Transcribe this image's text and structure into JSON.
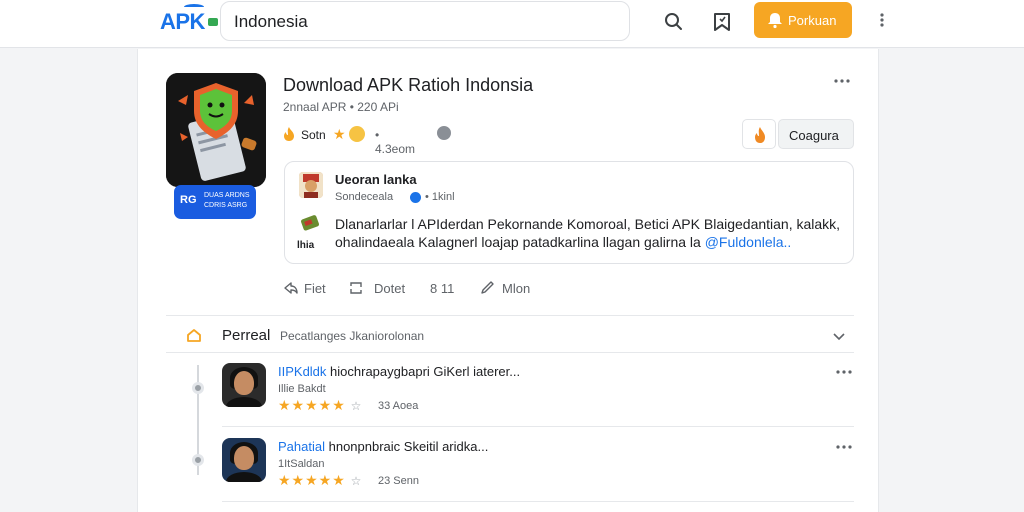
{
  "header": {
    "logo_text": "APK",
    "search": {
      "value": "Indonesia"
    },
    "primary_button_label": "Porkuan"
  },
  "app": {
    "badge_primary": "RG",
    "badge_secondary": "DUAS ARDNS CDRIS ASRG",
    "title": "Download APK Ratioh Indonsia",
    "subtitle": "2nnaal APR • 220 APi",
    "rating": "Sotn",
    "size": "• 4.3eom",
    "action_button_label": "Coagura"
  },
  "post": {
    "author": "Ueoran lanka",
    "handle": "Sondeceala",
    "time": "• 1kinl",
    "thumb_label": "lhia",
    "body_text": "Dlanarlarlar l APIderdan Pekornande Komoroal, Betici APK Blaigedantian, kalakk, ohalindaeala Kalagnerl loajap patadkarlina llagan galirna la",
    "mention": "@Fuldonlela.."
  },
  "post_actions": [
    {
      "label": "Fiet",
      "icon": "share-icon"
    },
    {
      "label": "Dotet",
      "icon": "repost-icon"
    },
    {
      "label": "8 11",
      "icon": ""
    },
    {
      "label": "Mlon",
      "icon": "reply-icon"
    }
  ],
  "section": {
    "title": "Perreal",
    "subtitle": "Pecatlanges Jkaniorolonan"
  },
  "reviews": [
    {
      "name": "IIPKdldk",
      "text": "hiochrapaygbapri GiKerl iaterer...",
      "sub": "Illie Bakdt",
      "stars": "★★★★★",
      "count": "33 Aoea"
    },
    {
      "name": "Pahatial",
      "text": "hnonpnbraic Skeitil aridka...",
      "sub": "1ItSaldan",
      "stars": "★★★★★",
      "count": "23 Senn"
    }
  ],
  "colors": {
    "accent": "#f6a623",
    "link": "#1a73e8",
    "badge": "#1a5ce0"
  }
}
